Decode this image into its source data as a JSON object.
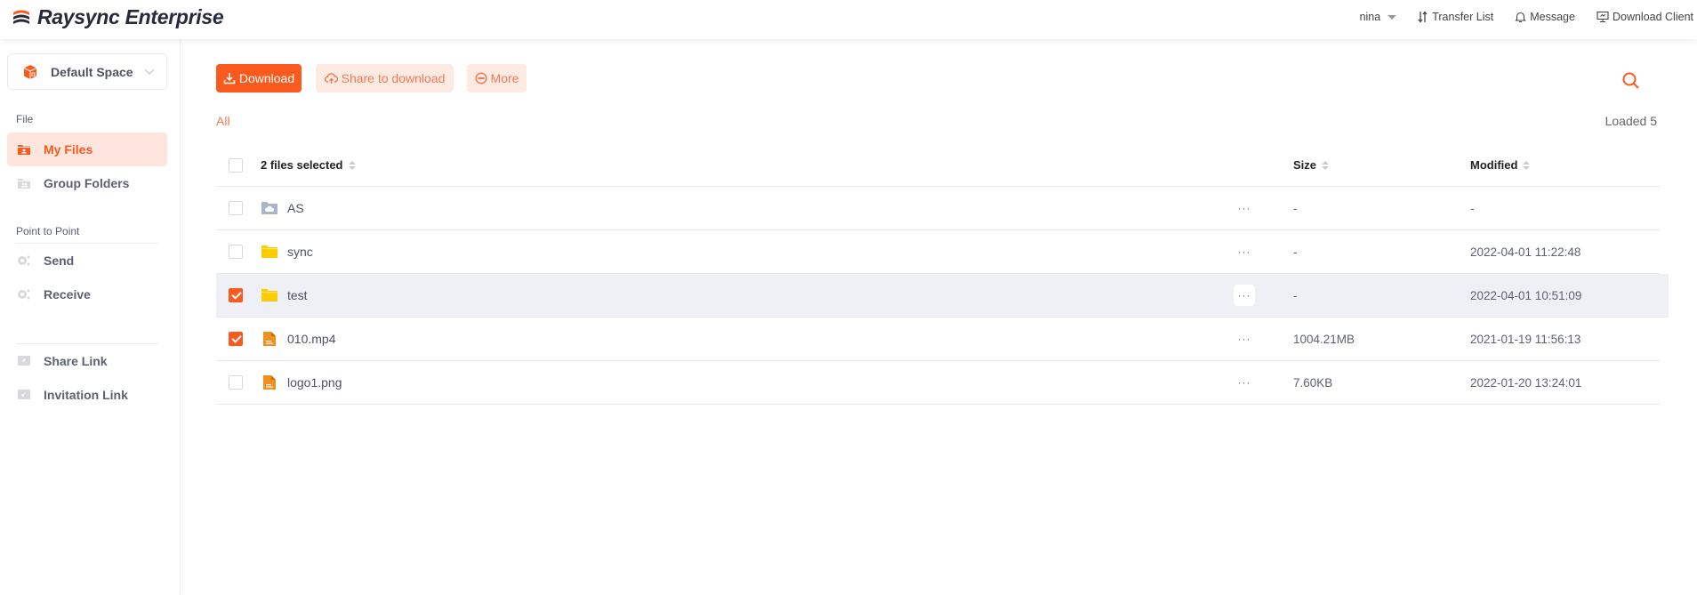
{
  "app": {
    "title": "Raysync Enterprise"
  },
  "header": {
    "user": "nina",
    "transfer_list": "Transfer List",
    "message": "Message",
    "download_client": "Download Client"
  },
  "sidebar": {
    "space": "Default Space",
    "sections": {
      "file": "File",
      "p2p": "Point to Point"
    },
    "items": [
      {
        "label": "My Files",
        "icon": "my-files-folder-icon",
        "active": true
      },
      {
        "label": "Group Folders",
        "icon": "group-folder-icon",
        "active": false
      },
      {
        "label": "Send",
        "icon": "send-icon",
        "active": false
      },
      {
        "label": "Receive",
        "icon": "receive-icon",
        "active": false
      },
      {
        "label": "Share Link",
        "icon": "share-link-icon",
        "active": false
      },
      {
        "label": "Invitation Link",
        "icon": "invitation-link-icon",
        "active": false
      }
    ]
  },
  "toolbar": {
    "download": "Download",
    "share": "Share to download",
    "more": "More",
    "search_icon": "search-icon"
  },
  "filter": {
    "all": "All",
    "loaded": "Loaded 5"
  },
  "table": {
    "headers": {
      "name": "2 files selected",
      "size": "Size",
      "modified": "Modified"
    },
    "rows": [
      {
        "name": "AS",
        "type": "cloud-folder",
        "size": "-",
        "modified": "-",
        "checked": false
      },
      {
        "name": "sync",
        "type": "folder",
        "size": "-",
        "modified": "2022-04-01 11:22:48",
        "checked": false
      },
      {
        "name": "test",
        "type": "folder",
        "size": "-",
        "modified": "2022-04-01 10:51:09",
        "checked": true
      },
      {
        "name": "010.mp4",
        "type": "file",
        "size": "1004.21MB",
        "modified": "2021-01-19 11:56:13",
        "checked": true
      },
      {
        "name": "logo1.png",
        "type": "file",
        "size": "7.60KB",
        "modified": "2022-01-20 13:24:01",
        "checked": false
      }
    ],
    "more_label": "···"
  },
  "colors": {
    "accent": "#fa5a1e",
    "accent_light": "#fdeae3",
    "row_highlight": "#eef0f5",
    "folder": "#ffcc00",
    "file": "#f0901e"
  }
}
